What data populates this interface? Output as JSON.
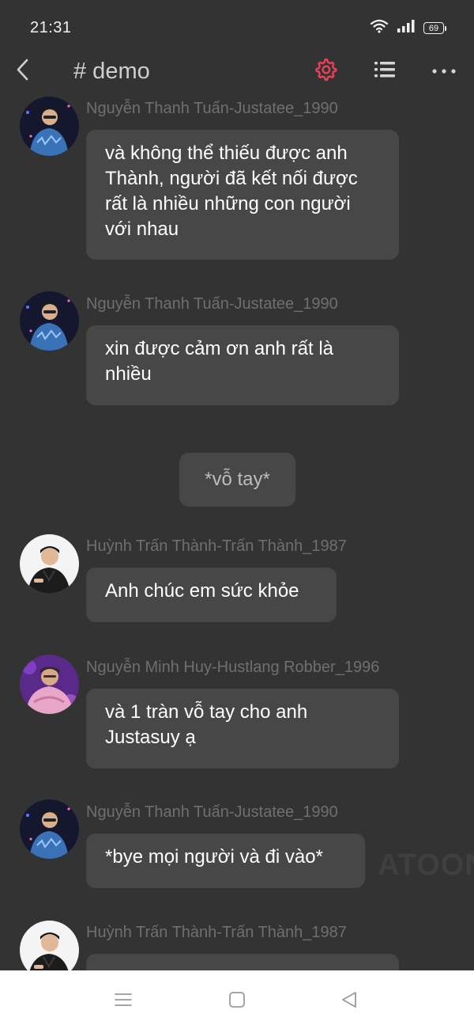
{
  "status_bar": {
    "time": "21:31",
    "battery": "69",
    "icons": [
      "wifi-icon",
      "signal-icon",
      "battery-icon"
    ]
  },
  "header": {
    "title": "# demo",
    "icons": [
      "back-arrow-icon",
      "gear-icon",
      "list-icon",
      "more-dots-icon"
    ],
    "accent_color": "#e8415a"
  },
  "messages": [
    {
      "sender": "Nguyễn Thanh Tuấn-Justatee_1990",
      "lines": [
        "và không thể thiếu được anh",
        "Thành, người đã kết nối được",
        "rất là nhiều những con người",
        "với nhau"
      ]
    },
    {
      "sender": "Nguyễn Thanh Tuấn-Justatee_1990",
      "lines": [
        "xin được cảm ơn anh rất là",
        "nhiều"
      ]
    },
    {
      "action": "*vỗ tay*"
    },
    {
      "sender": "Huỳnh Trấn Thành-Trấn Thành_1987",
      "lines": [
        "Anh chúc em sức khỏe"
      ]
    },
    {
      "sender": "Nguyễn Minh Huy-Hustlang Robber_1996",
      "lines": [
        "và 1 tràn vỗ tay cho anh",
        "Justasuy ạ"
      ]
    },
    {
      "sender": "Nguyễn Thanh Tuấn-Justatee_1990",
      "lines": [
        "*bye mọi người và đi vào*"
      ]
    },
    {
      "sender": "Huỳnh Trấn Thành-Trấn Thành_1987",
      "lines": []
    }
  ],
  "watermark": "ATOON",
  "nav_bar": {
    "icons": [
      "menu-icon",
      "home-square-icon",
      "back-triangle-icon"
    ]
  }
}
